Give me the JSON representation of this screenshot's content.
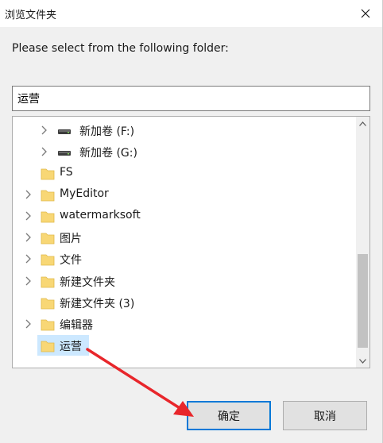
{
  "dialog": {
    "title": "浏览文件夹",
    "prompt": "Please select from the following folder:",
    "path_value": "运营",
    "ok_label": "确定",
    "cancel_label": "取消"
  },
  "tree": {
    "items": [
      {
        "label": "新加卷 (F:)",
        "icon": "drive-icon",
        "expandable": true,
        "level": 1
      },
      {
        "label": "新加卷 (G:)",
        "icon": "drive-icon",
        "expandable": true,
        "level": 1
      },
      {
        "label": "FS",
        "icon": "folder-icon",
        "expandable": false,
        "level": 0
      },
      {
        "label": "MyEditor",
        "icon": "folder-icon",
        "expandable": true,
        "level": 0
      },
      {
        "label": "watermarksoft",
        "icon": "folder-icon",
        "expandable": true,
        "level": 0
      },
      {
        "label": "图片",
        "icon": "folder-icon",
        "expandable": true,
        "level": 0
      },
      {
        "label": "文件",
        "icon": "folder-icon",
        "expandable": true,
        "level": 0
      },
      {
        "label": "新建文件夹",
        "icon": "folder-icon",
        "expandable": true,
        "level": 0
      },
      {
        "label": "新建文件夹 (3)",
        "icon": "folder-icon",
        "expandable": false,
        "level": 0
      },
      {
        "label": "编辑器",
        "icon": "folder-icon",
        "expandable": true,
        "level": 0
      },
      {
        "label": "运营",
        "icon": "folder-icon",
        "expandable": false,
        "level": 0,
        "selected": true
      }
    ]
  },
  "colors": {
    "accent": "#0078d7",
    "selection": "#cce8ff",
    "folder": "#f8d775",
    "annotation_arrow": "#e8262b"
  }
}
